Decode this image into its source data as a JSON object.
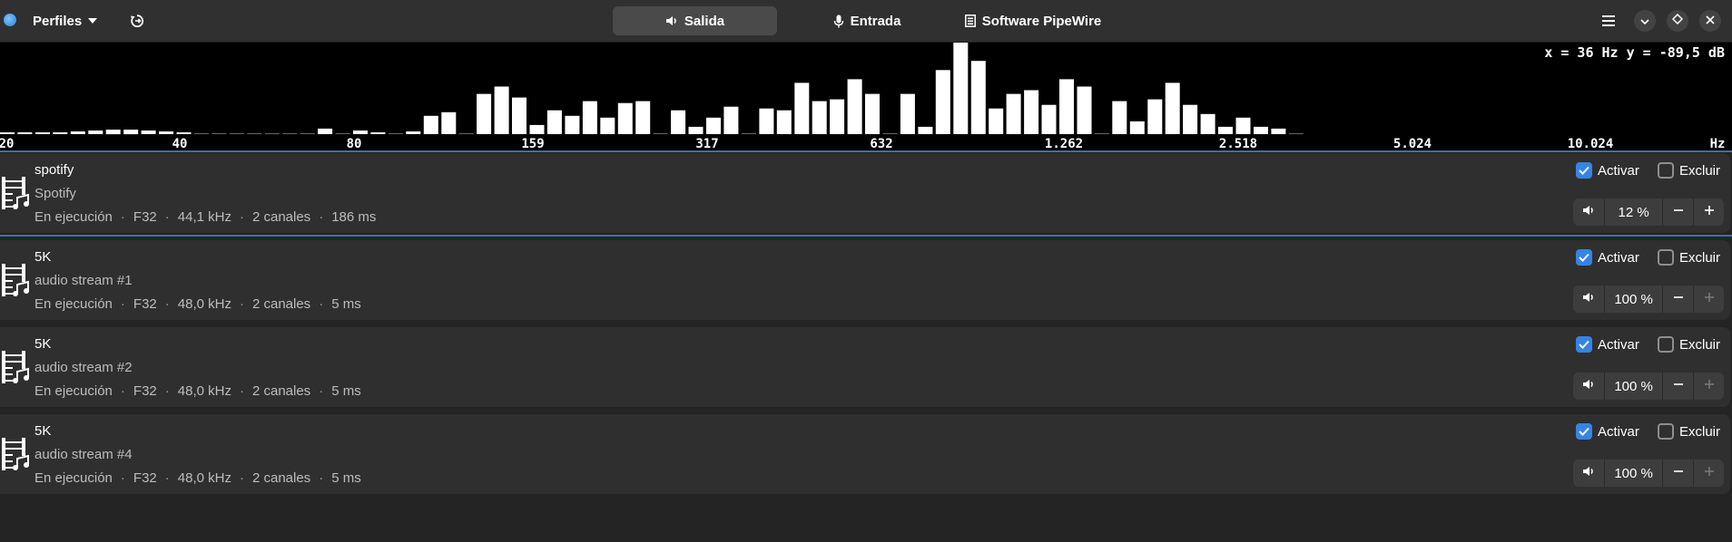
{
  "header": {
    "profiles_label": "Perfiles",
    "tabs": [
      {
        "label": "Salida",
        "icon": "speaker-icon",
        "active": true
      },
      {
        "label": "Entrada",
        "icon": "microphone-icon",
        "active": false
      },
      {
        "label": "Software PipeWire",
        "icon": "document-icon",
        "active": false
      }
    ]
  },
  "spectrum": {
    "coordinate_readout": "x = 36 Hz y = -89,5 dB",
    "freq_labels": [
      "20",
      "40",
      "80",
      "159",
      "317",
      "632",
      "1.262",
      "2.518",
      "5.024",
      "10.024",
      "Hz"
    ],
    "bars": [
      2,
      2,
      2,
      2,
      3,
      4,
      5,
      5,
      4,
      3,
      2,
      1,
      1,
      1,
      1,
      0,
      0,
      0,
      6,
      0,
      4,
      2,
      0,
      3,
      20,
      24,
      0,
      44,
      52,
      40,
      10,
      26,
      20,
      36,
      18,
      34,
      36,
      0,
      26,
      8,
      18,
      30,
      0,
      28,
      26,
      56,
      36,
      38,
      60,
      44,
      0,
      44,
      8,
      70,
      100,
      80,
      28,
      44,
      48,
      32,
      60,
      52,
      0,
      36,
      14,
      38,
      56,
      32,
      22,
      8,
      18,
      8,
      6,
      1
    ]
  },
  "streams": [
    {
      "title": "spotify",
      "subtitle": "Spotify",
      "state": "En ejecución",
      "format": "F32",
      "rate": "44,1 kHz",
      "channels": "2 canales",
      "latency": "186 ms",
      "enable_label": "Activar",
      "exclude_label": "Excluir",
      "enabled": true,
      "excluded": false,
      "volume": "12 %"
    },
    {
      "title": "5K",
      "subtitle": "audio stream #1",
      "state": "En ejecución",
      "format": "F32",
      "rate": "48,0 kHz",
      "channels": "2 canales",
      "latency": "5 ms",
      "enable_label": "Activar",
      "exclude_label": "Excluir",
      "enabled": true,
      "excluded": false,
      "volume": "100 %"
    },
    {
      "title": "5K",
      "subtitle": "audio stream #2",
      "state": "En ejecución",
      "format": "F32",
      "rate": "48,0 kHz",
      "channels": "2 canales",
      "latency": "5 ms",
      "enable_label": "Activar",
      "exclude_label": "Excluir",
      "enabled": true,
      "excluded": false,
      "volume": "100 %"
    },
    {
      "title": "5K",
      "subtitle": "audio stream #4",
      "state": "En ejecución",
      "format": "F32",
      "rate": "48,0 kHz",
      "channels": "2 canales",
      "latency": "5 ms",
      "enable_label": "Activar",
      "exclude_label": "Excluir",
      "enabled": true,
      "excluded": false,
      "volume": "100 %"
    }
  ],
  "colors": {
    "accent": "#3584e4",
    "card": "#2f2f2f",
    "window": "#242424"
  }
}
